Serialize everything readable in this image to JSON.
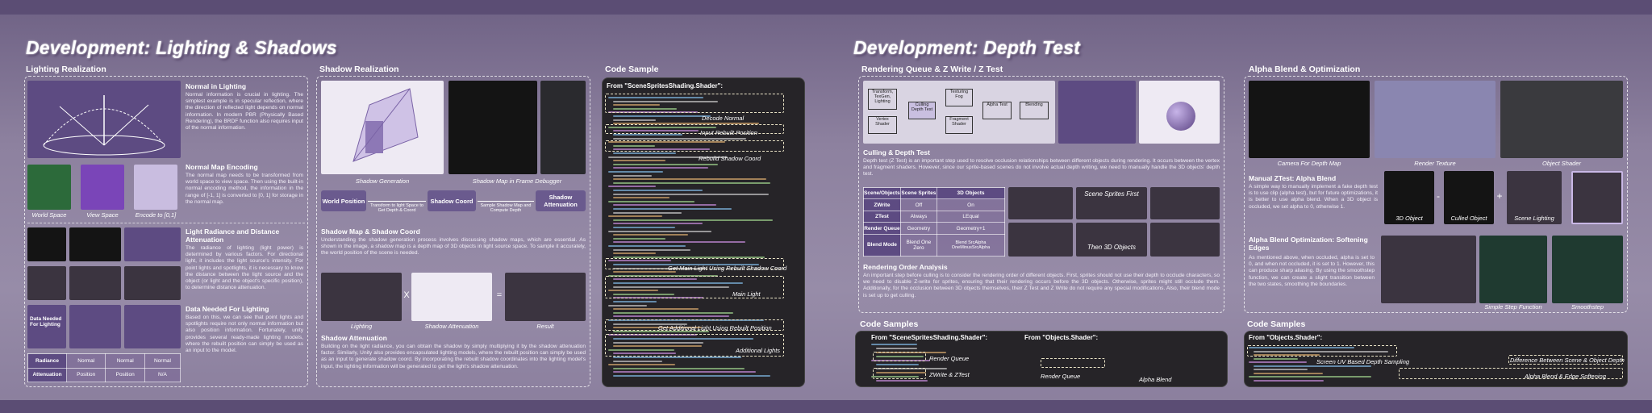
{
  "titles": {
    "left": "Development: Lighting & Shadows",
    "right": "Development: Depth Test"
  },
  "panels": {
    "lighting_realization": "Lighting Realization",
    "shadow_realization": "Shadow Realization",
    "code_sample": "Code Sample",
    "rendering_queue": "Rendering Queue & Z Write / Z Test",
    "alpha_blend": "Alpha Blend & Optimization",
    "code_samples_mid": "Code Samples",
    "code_samples_right": "Code Samples"
  },
  "lighting": {
    "normal_h": "Normal in Lighting",
    "normal_text": "Normal information is crucial in lighting. The simplest example is in specular reflection, where the direction of reflected light depends on normal information. In modern PBR (Physically Based Rendering), the BRDF function also requires input of the normal information.",
    "map_h": "Normal Map Encoding",
    "map_text": "The normal map needs to be transformed from world space to view space. Then using the built-in normal encoding method, the information in the range of [-1, 1] is converted to [0, 1] for storage in the normal map.",
    "cap_world": "World Space",
    "cap_view": "View Space",
    "cap_encode": "Encode to [0,1]",
    "radiance_h": "Light Radiance and Distance Attenuation",
    "radiance_text": "The radiance of lighting (light power) is determined by various factors. For directional light, it includes the light source's intensity. For point lights and spotlights, it is necessary to know the distance between the light source and the object (or light and the object's specific position), to determine distance attenuation.",
    "data_h": "Data Needed For Lighting",
    "data_text": "Based on this, we can see that point lights and spotlights require not only normal information but also position information. Fortunately, unity provides several ready-made lighting models, where the rebuilt position can simply be used as an input to the model.",
    "data_box": "Data Needed For Lighting",
    "rows": [
      {
        "name": "Radiance",
        "a": "Normal",
        "b": "Normal",
        "c": "Normal"
      },
      {
        "name": "Attenuation",
        "a": "Position",
        "b": "Position",
        "c": "N/A"
      }
    ]
  },
  "shadow": {
    "cap_gen": "Shadow Generation",
    "cap_map": "Shadow Map in Frame Debugger",
    "flow": [
      "World Position",
      "Shadow Coord",
      "Shadow Attenuation"
    ],
    "flow_note1": "Transform to light Space to Get Depth & Coord",
    "flow_note2": "Sample Shadow Map and Compute Depth",
    "coord_h": "Shadow Map &  Shadow Coord",
    "coord_text": "Understanding the shadow generation process involves discussing shadow maps, which are essential. As shown in the image, a shadow map is a depth map of 3D objects in light source space. To sample it accurately, the world position of the scene is needed.",
    "cap_lighting": "Lighting",
    "cap_atten": "Shadow Attenuation",
    "cap_result": "Result",
    "op_x": "X",
    "op_eq": "=",
    "atten_h": "Shadow Attenuation",
    "atten_text": "Building on the light radiance, you can obtain the shadow by simply multiplying it by the shadow attenuation factor. Similarly, Unity also provides encapsulated lighting models, where the rebuilt position can simply be used as an input to generate shadow coord. By incorporating the rebuilt shadow coordinates into the lighting model's input, the lighting information will be generated to get the light's shadow attenuation."
  },
  "code": {
    "from": "From \"SceneSpritesShading.Shader\":",
    "labels": [
      "Decode Normal",
      "Input Rebuilt Position",
      "Rebuild Shadow Coord",
      "Get Main Light Using Rebuilt Shadow Coord",
      "Main Light",
      "Get Additional Light Using Rebuilt Position",
      "Additional Lights"
    ]
  },
  "depth": {
    "pipeline": [
      "Transform, TexGen, Lighting",
      "Vertex Shader",
      "Culling Depth Test",
      "Texturing Fog",
      "Fragment Shader",
      "Alpha Test",
      "Blending"
    ],
    "cull_h": "Culling & Depth Test",
    "cull_text": "Depth test (Z Test) is an important step used to resolve occlusion relationships between different objects during rendering. It occurs between the vertex and fragment shaders. However, since our sprite-based scenes do not involve actual depth writing, we need to manually handle the 3D objects' depth test.",
    "table_head": [
      "Scene/Objects",
      "Scene Sprites",
      "3D Objects"
    ],
    "table_rows": [
      {
        "name": "ZWrite",
        "a": "Off",
        "b": "On"
      },
      {
        "name": "ZTest",
        "a": "Always",
        "b": "LEqual"
      },
      {
        "name": "Render Queue",
        "a": "Geometry",
        "b": "Geometry+1"
      },
      {
        "name": "Blend Mode",
        "a": "Blend One Zero",
        "b": "Blend SrcAlpha OneMinusSrcAlpha"
      }
    ],
    "first_a": "Scene Sprites First",
    "first_b": "Then 3D Objects",
    "order_h": "Rendering Order Analysis",
    "order_text": "An important step before culling is to consider the rendering order of different objects. First, sprites should not use their depth to occlude characters, so we need to disable Z-write for sprites, ensuring that their rendering occurs before the 3D objects. Otherwise, sprites might still occlude them. Additionally, for the occlusion between 3D objects themselves, their Z Test and Z Write do not require any special modifications. Also, their blend mode is set up to get culling."
  },
  "code_mid": {
    "from1": "From \"SceneSpritesShading.Shader\":",
    "from2": "From \"Objects.Shader\":",
    "l1": "Render Queue",
    "l2": "ZWrite & ZTest",
    "l3": "Render Queue",
    "l4": "Alpha Blend"
  },
  "alpha": {
    "cap_a": "Camera For Depth Map",
    "cap_b": "Render Texture",
    "cap_c": "Object Shader",
    "manual_h": "Manual ZTest: Alpha Blend",
    "manual_text": "A simple way to manually implement a fake depth test is to use clip (alpha test), but for future optimizations, it is better to use alpha blend. When a 3D object is occluded, we set alpha to 0, otherwise 1.",
    "cap_3d": "3D Object",
    "cap_cull": "Culled Object",
    "cap_scene": "Scene Lighting",
    "op_minus": "-",
    "op_plus": "+",
    "opt_h": "Alpha Blend Optimization: Softening Edges",
    "opt_text": "As mentioned above, when occluded, alpha is set to 0, and when not occluded, it is set to 1. However, this can produce sharp aliasing. By using the smoothstep function, we can create a slight transition between the two states, smoothing the boundaries.",
    "cap_step": "Simple Step Function",
    "cap_smooth": "Smoothstep"
  },
  "code_right": {
    "from": "From \"Objects.Shader\":",
    "l1": "Screen UV Based Depth Sampling",
    "l2": "Difference Between Scene & Object Depth",
    "l3": "Alpha Blend & Edge Softening"
  }
}
